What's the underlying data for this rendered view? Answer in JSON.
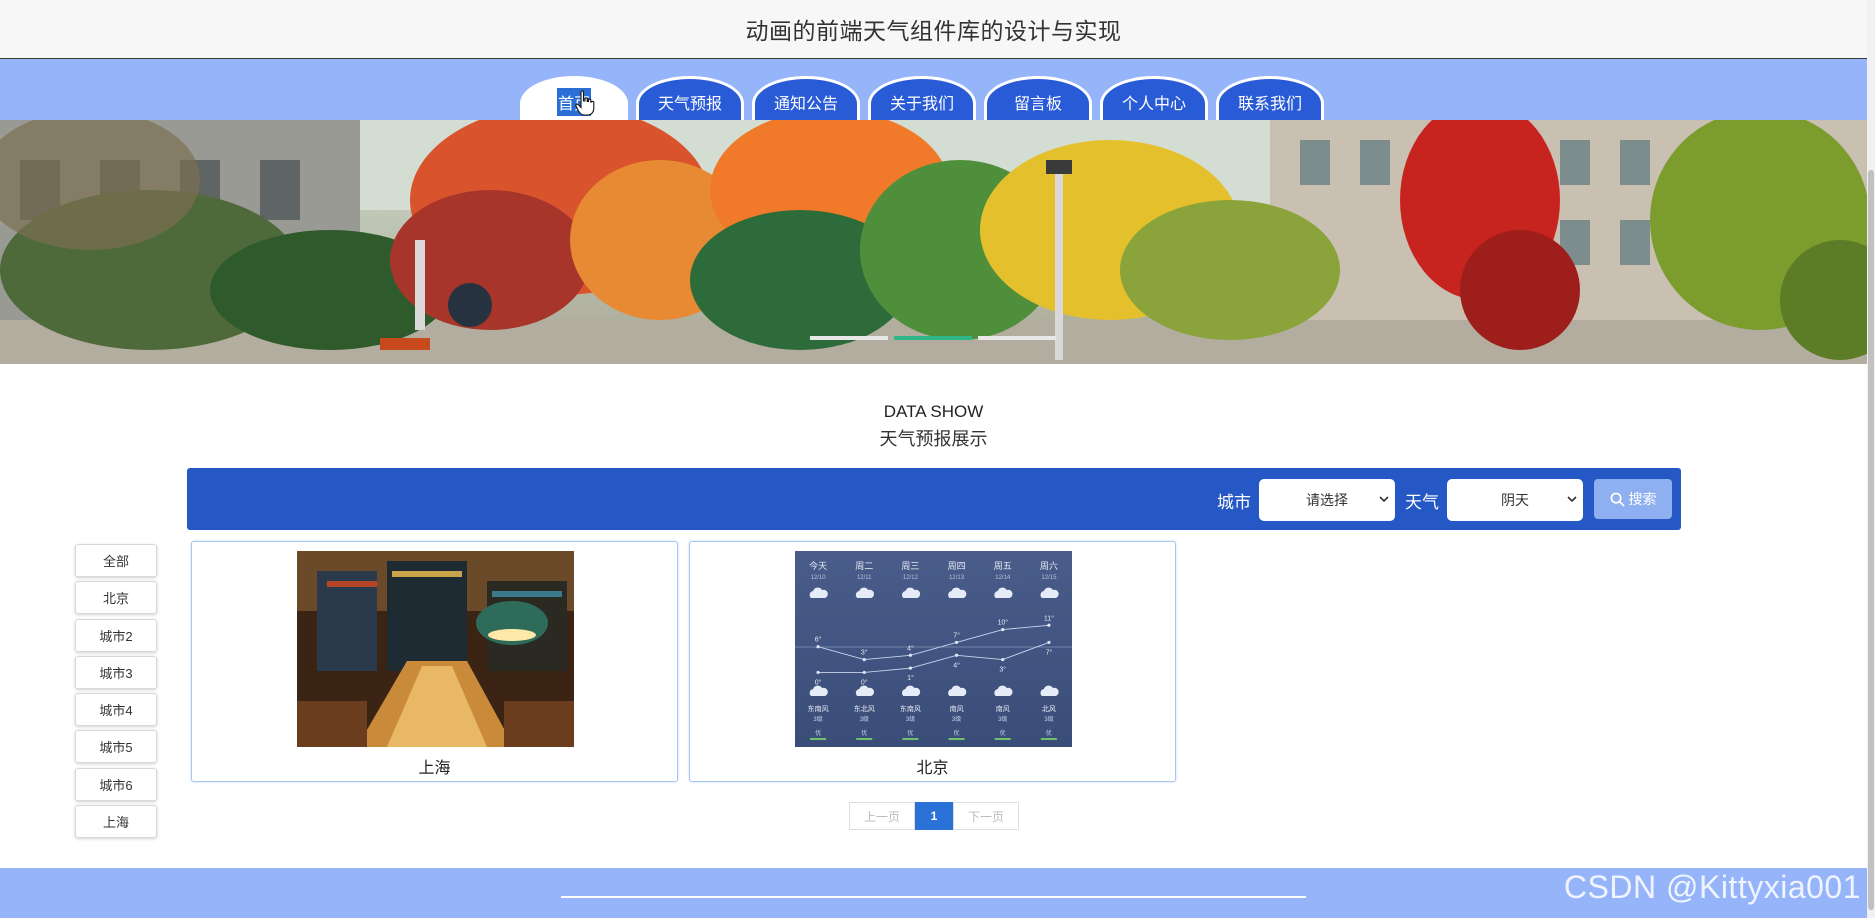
{
  "header": {
    "title": "动画的前端天气组件库的设计与实现"
  },
  "nav": {
    "tabs": [
      {
        "label": "首页",
        "active": true
      },
      {
        "label": "天气预报"
      },
      {
        "label": "通知公告"
      },
      {
        "label": "关于我们"
      },
      {
        "label": "留言板"
      },
      {
        "label": "个人中心"
      },
      {
        "label": "联系我们"
      }
    ]
  },
  "banner": {
    "slides": 3,
    "active_slide": 2
  },
  "section": {
    "title_en": "DATA SHOW",
    "title_cn": "天气预报展示"
  },
  "search": {
    "city_label": "城市",
    "city_value": "请选择",
    "weather_label": "天气",
    "weather_value": "阴天",
    "button_label": "搜索"
  },
  "sidebar": {
    "items": [
      "全部",
      "北京",
      "城市2",
      "城市3",
      "城市4",
      "城市5",
      "城市6",
      "上海"
    ]
  },
  "cards": [
    {
      "caption": "上海",
      "image": "library-photo"
    },
    {
      "caption": "北京",
      "image": "weather-forecast",
      "forecast": {
        "days": [
          "今天",
          "周二",
          "周三",
          "周四",
          "周五",
          "周六"
        ],
        "dates": [
          "12/10",
          "12/11",
          "12/12",
          "12/13",
          "12/14",
          "12/15"
        ],
        "highs": [
          "6°",
          "3°",
          "4°",
          "7°",
          "10°",
          "11°"
        ],
        "lows": [
          "0°",
          "0°",
          "1°",
          "4°",
          "3°",
          "7°"
        ],
        "winds": [
          "东南风",
          "东北风",
          "东南风",
          "南风",
          "南风",
          "北风"
        ],
        "levels": [
          "3级",
          "3级",
          "3级",
          "3级",
          "3级",
          "3级"
        ],
        "aqi": [
          "优",
          "优",
          "优",
          "优",
          "优",
          "优"
        ]
      }
    }
  ],
  "pagination": {
    "prev": "上一页",
    "current": "1",
    "next": "下一页"
  },
  "watermark": "CSDN @Kittyxia001",
  "colors": {
    "nav_bg": "#95b4f9",
    "tab_bg": "#2a5bd7",
    "search_bg": "#2557c5",
    "accent": "#2a72d8"
  }
}
